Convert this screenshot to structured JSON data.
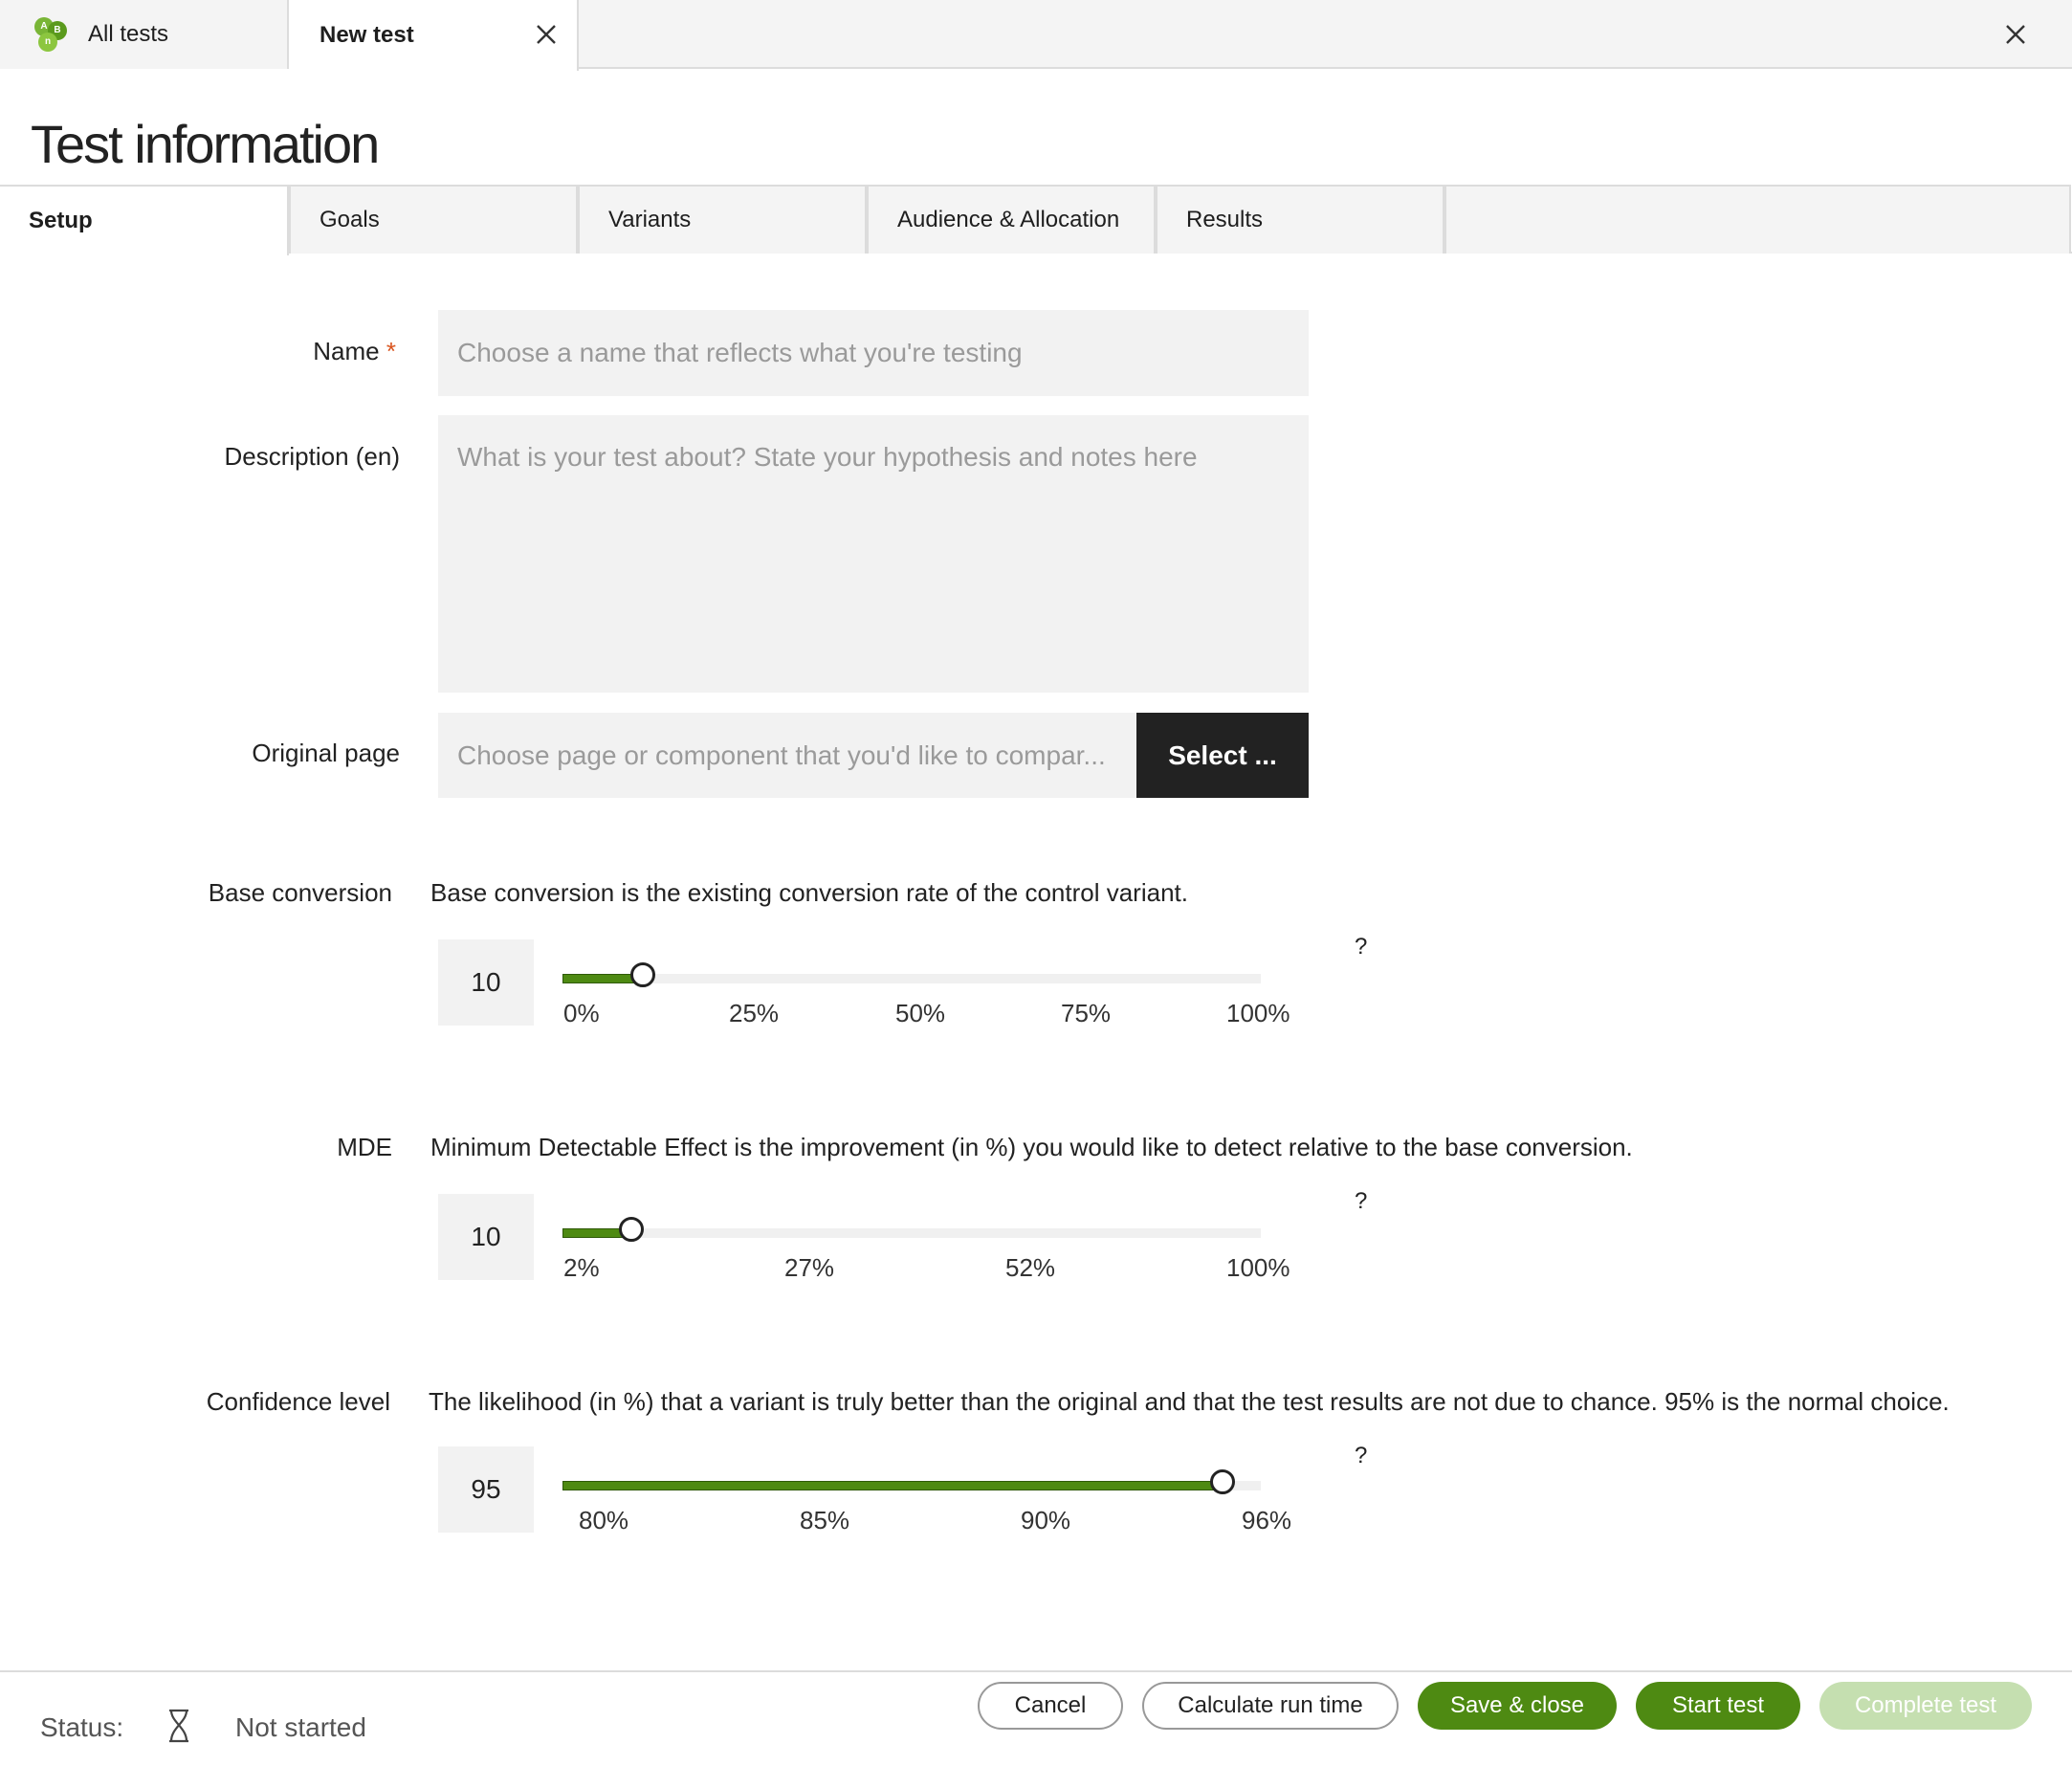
{
  "colors": {
    "accent": "#4e8a12",
    "required": "#d9541e",
    "disabled": "#c5dfb0"
  },
  "topbar": {
    "all_tests_label": "All tests",
    "new_test_label": "New test",
    "logo_letters": [
      "A",
      "B",
      "n"
    ]
  },
  "page_title": "Test information",
  "tabs": [
    {
      "label": "Setup",
      "active": true
    },
    {
      "label": "Goals",
      "active": false
    },
    {
      "label": "Variants",
      "active": false
    },
    {
      "label": "Audience & Allocation",
      "active": false
    },
    {
      "label": "Results",
      "active": false
    }
  ],
  "form": {
    "name": {
      "label": "Name",
      "required_mark": "*",
      "value": "",
      "placeholder": "Choose a name that reflects what you're testing"
    },
    "description": {
      "label": "Description (en)",
      "value": "",
      "placeholder": "What is your test about? State your hypothesis and notes here"
    },
    "original_page": {
      "label": "Original page",
      "placeholder": "Choose page or component that you'd like to compar...",
      "button_label": "Select ..."
    }
  },
  "sliders": {
    "base_conversion": {
      "label": "Base conversion",
      "help": "Base conversion is the existing conversion rate of the control variant.",
      "value": "10",
      "ticks": [
        "0%",
        "25%",
        "50%",
        "75%",
        "100%"
      ],
      "help_marker": "?"
    },
    "mde": {
      "label": "MDE",
      "help": "Minimum Detectable Effect is the improvement (in %) you would like to detect relative to the base conversion.",
      "value": "10",
      "ticks": [
        "2%",
        "27%",
        "52%",
        "100%"
      ],
      "help_marker": "?"
    },
    "confidence": {
      "label": "Confidence level",
      "help": "The likelihood (in %) that a variant is truly better than the original and that the test results are not due to chance. 95% is the normal choice.",
      "value": "95",
      "ticks": [
        "80%",
        "85%",
        "90%",
        "96%"
      ],
      "help_marker": "?"
    }
  },
  "footer": {
    "status_label": "Status:",
    "status_value": "Not started",
    "buttons": {
      "cancel": "Cancel",
      "calculate": "Calculate run time",
      "save_close": "Save & close",
      "start": "Start test",
      "complete": "Complete test"
    }
  }
}
